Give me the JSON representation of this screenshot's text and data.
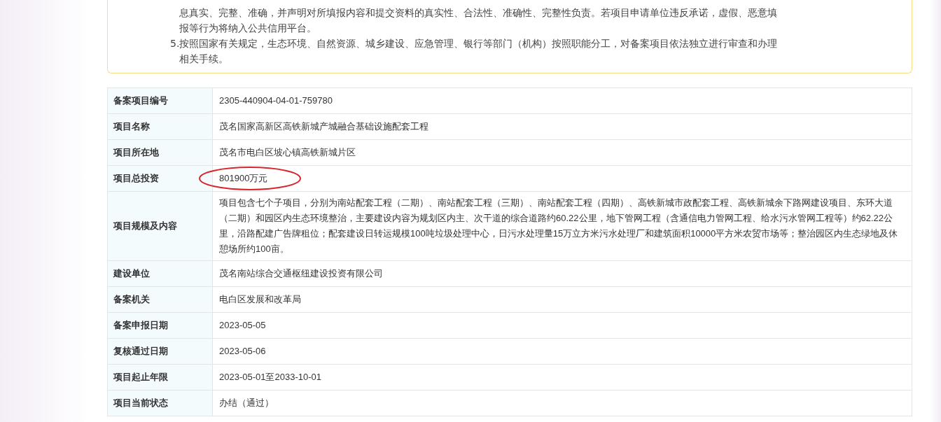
{
  "notice": {
    "items": [
      {
        "text": "息真实、完整、准确，并声明对所填报内容和提交资料的真实性、合法性、准确性、完整性负责。若项目申请单位违反承诺，虚假、恶意填报等行为将纳入公共信用平台。"
      },
      {
        "number": "5.",
        "text": "按照国家有关规定，生态环境、自然资源、城乡建设、应急管理、银行等部门（机构）按照职能分工，对备案项目依法独立进行审查和办理相关手续。"
      }
    ]
  },
  "table": {
    "rows": [
      {
        "label": "备案项目编号",
        "value": "2305-440904-04-01-759780",
        "circled": false
      },
      {
        "label": "项目名称",
        "value": "茂名国家高新区高铁新城产城融合基础设施配套工程",
        "circled": false
      },
      {
        "label": "项目所在地",
        "value": "茂名市电白区坡心镇高铁新城片区",
        "circled": false
      },
      {
        "label": "项目总投资",
        "value": "801900万元",
        "circled": true
      },
      {
        "label": "项目规模及内容",
        "value": "项目包含七个子项目，分别为南站配套工程（二期）、南站配套工程（三期）、南站配套工程（四期）、高铁新城市政配套工程、高铁新城余下路网建设项目、东环大道（二期）和园区内生态环境整治，主要建设内容为规划区内主、次干道的综合道路约60.22公里，地下管网工程（含通信电力管网工程、给水污水管网工程等）约62.22公里，沿路配建广告牌租位；配套建设日转运规模100吨垃圾处理中心，日污水处理量15万立方米污水处理厂和建筑面积10000平方米农贸市场等；整治园区内生态绿地及休憩场所约100亩。",
        "circled": false
      },
      {
        "label": "建设单位",
        "value": "茂名南站综合交通枢纽建设投资有限公司",
        "circled": false
      },
      {
        "label": "备案机关",
        "value": "电白区发展和改革局",
        "circled": false
      },
      {
        "label": "备案申报日期",
        "value": "2023-05-05",
        "circled": false
      },
      {
        "label": "复核通过日期",
        "value": "2023-05-06",
        "circled": false
      },
      {
        "label": "项目起止年限",
        "value": "2023-05-01至2033-10-01",
        "circled": false
      },
      {
        "label": "项目当前状态",
        "value": "办结（通过）",
        "circled": false
      }
    ]
  }
}
